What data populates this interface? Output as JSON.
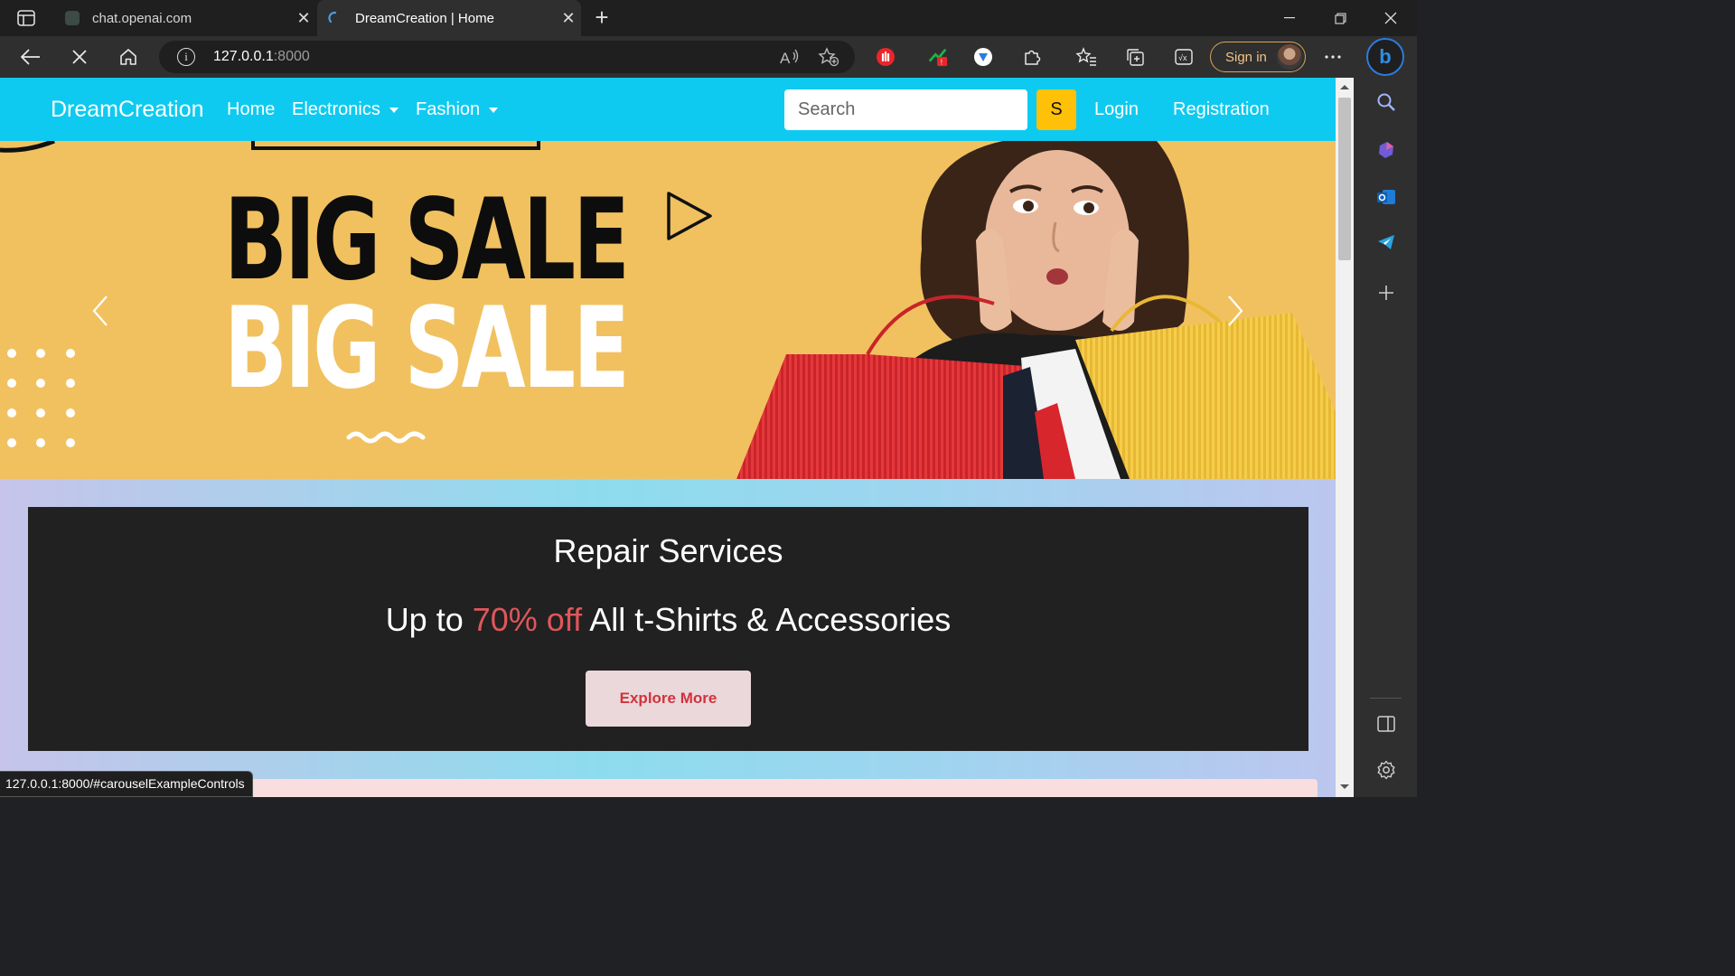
{
  "browser": {
    "tabs": [
      {
        "title": "chat.openai.com",
        "active": false
      },
      {
        "title": "DreamCreation | Home",
        "active": true
      }
    ],
    "address": {
      "host": "127.0.0.1",
      "port": ":8000"
    },
    "signin_label": "Sign in",
    "status_url": "127.0.0.1:8000/#carouselExampleControls"
  },
  "site": {
    "brand": "DreamCreation",
    "nav": {
      "home": "Home",
      "electronics": "Electronics",
      "fashion": "Fashion",
      "login": "Login",
      "registration": "Registration"
    },
    "search": {
      "placeholder": "Search",
      "button": "S"
    }
  },
  "carousel": {
    "line1": "BIG SALE",
    "line2": "BIG SALE",
    "bg_color": "#f1c160"
  },
  "promo": {
    "title": "Repair Services",
    "offer_prefix": "Up to ",
    "offer_highlight": "70% off",
    "offer_suffix": " All t-Shirts & Accessories",
    "button": "Explore More",
    "highlight_color": "#e0565b"
  },
  "colors": {
    "navbar": "#0fcaf0",
    "search_button": "#ffc107",
    "promo_bg": "#212121"
  }
}
